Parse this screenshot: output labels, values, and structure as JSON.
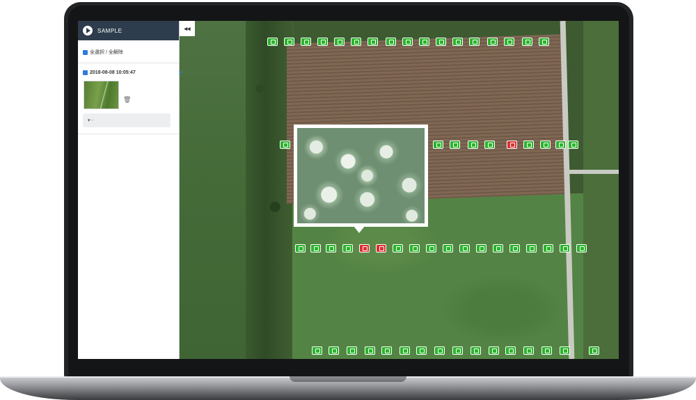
{
  "sidebar": {
    "title": "SAMPLE",
    "select_all_label": "全選択 / 全解除",
    "entry_date": "2018-08-08 10:05:47",
    "close_mark": "✕",
    "dropdown_value": "▾ -",
    "collapse_label": "◂◂"
  },
  "icons": {
    "play": "play-icon",
    "trash": "trash-icon",
    "marker": "camera-marker-icon"
  },
  "colors": {
    "marker_ok": "#2bb32b",
    "marker_alert": "#d93030",
    "sidebar_header": "#2e3d4d"
  }
}
